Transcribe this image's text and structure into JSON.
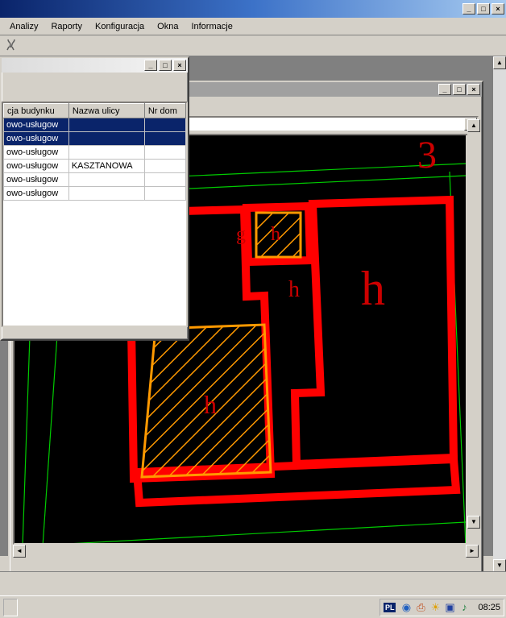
{
  "window_controls": {
    "min": "_",
    "max": "□",
    "close": "×"
  },
  "menu": [
    "Analizy",
    "Raporty",
    "Konfiguracja",
    "Okna",
    "Informacje"
  ],
  "table_window": {
    "columns": [
      "cja budynku",
      "Nazwa ulicy",
      "Nr dom"
    ],
    "rows": [
      {
        "c0": "owo-usługow",
        "c1": "",
        "c2": "",
        "selected": true
      },
      {
        "c0": "owo-usługow",
        "c1": "",
        "c2": "",
        "selected": true
      },
      {
        "c0": "owo-usługow",
        "c1": "",
        "c2": "",
        "selected": false
      },
      {
        "c0": "owo-usługow",
        "c1": "KASZTANOWA",
        "c2": "",
        "selected": false
      },
      {
        "c0": "owo-usługow",
        "c1": "",
        "c2": "",
        "selected": false
      },
      {
        "c0": "owo-usługow",
        "c1": "",
        "c2": "",
        "selected": false
      }
    ]
  },
  "map": {
    "labels": {
      "big_h": "h",
      "small_h": "h",
      "g": "g",
      "top3": "3"
    }
  },
  "status_coords": ". -------- -- . . ---------- .",
  "taskbar": {
    "lang": "PL",
    "clock": "08:25"
  }
}
